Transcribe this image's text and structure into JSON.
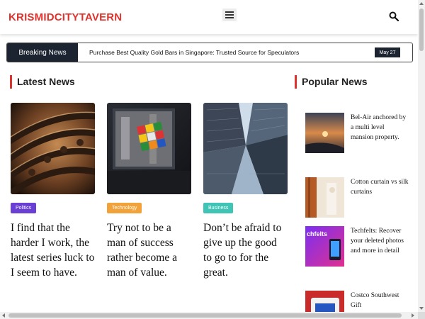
{
  "header": {
    "logo": "KRISMIDCITYTAVERN",
    "menu_icon": "hamburger-menu-icon",
    "search_icon": "search-icon"
  },
  "breaking": {
    "label": "Breaking News",
    "headline": "Purchase Best Quality Gold Bars in Singapore:  Trusted Source for Speculators",
    "date": "May 27"
  },
  "latest": {
    "title": "Latest News",
    "cards": [
      {
        "category": "Politics",
        "category_color": "#6a3fd4",
        "title": "I find that the harder I work, the latest series luck to I seem to have."
      },
      {
        "category": "Technology",
        "category_color": "#f2a23a",
        "title": "Try not to be a man of success rather become a man of value."
      },
      {
        "category": "Business",
        "category_color": "#3fc4b5",
        "title": "Don’t be afraid to give up the good to go to for the great."
      }
    ]
  },
  "popular": {
    "title": "Popular News",
    "items": [
      {
        "title": "Bel-Air anchored by a multi level mansion property."
      },
      {
        "title": "Cotton curtain vs silk curtains"
      },
      {
        "title": "Techfelts: Recover your deleted photos and more in detail",
        "thumb_text": "chfelts"
      },
      {
        "title": "Costco Southwest Gift"
      }
    ]
  },
  "colors": {
    "accent": "#e0322c",
    "dark": "#1c2431"
  }
}
